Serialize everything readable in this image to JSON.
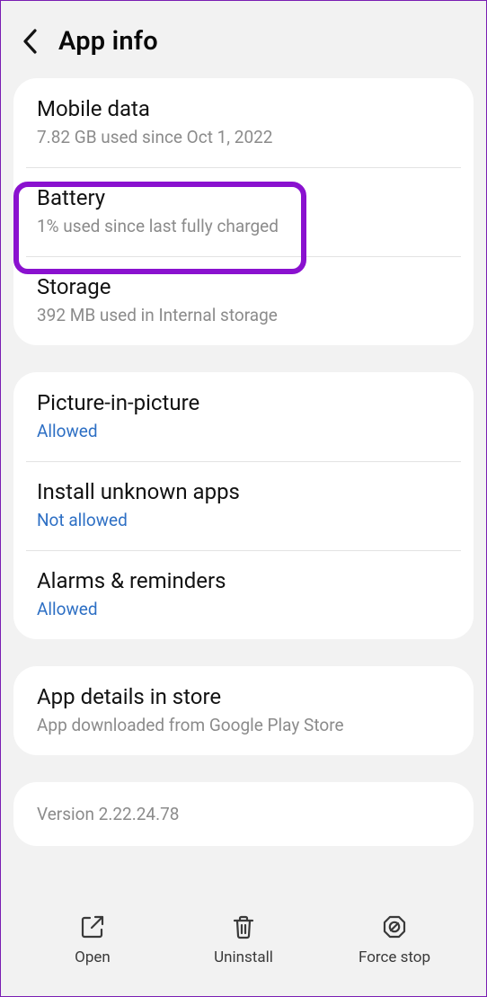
{
  "header": {
    "title": "App info"
  },
  "groups": {
    "usage": [
      {
        "title": "Mobile data",
        "sub": "7.82 GB used since Oct 1, 2022",
        "link": false
      },
      {
        "title": "Battery",
        "sub": "1% used since last fully charged",
        "link": false
      },
      {
        "title": "Storage",
        "sub": "392 MB used in Internal storage",
        "link": false
      }
    ],
    "permissions": [
      {
        "title": "Picture-in-picture",
        "sub": "Allowed",
        "link": true
      },
      {
        "title": "Install unknown apps",
        "sub": "Not allowed",
        "link": true
      },
      {
        "title": "Alarms & reminders",
        "sub": "Allowed",
        "link": true
      }
    ],
    "store": [
      {
        "title": "App details in store",
        "sub": "App downloaded from Google Play Store",
        "link": false
      }
    ]
  },
  "version": "Version 2.22.24.78",
  "bottom": {
    "open": "Open",
    "uninstall": "Uninstall",
    "force_stop": "Force stop"
  }
}
